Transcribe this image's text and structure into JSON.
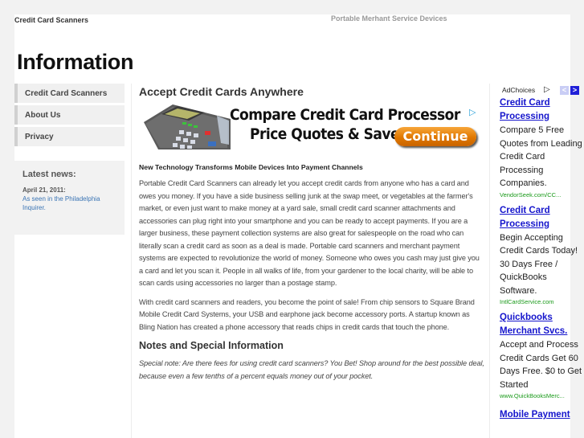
{
  "header": {
    "site_title": "Credit Card Scanners",
    "tagline": "Portable Merhant Service Devices",
    "page_heading": "Information"
  },
  "sidebar": {
    "nav": [
      {
        "label": "Credit Card Scanners"
      },
      {
        "label": "About Us"
      },
      {
        "label": "Privacy"
      }
    ],
    "news": {
      "heading": "Latest news:",
      "date": "April 21, 2011:",
      "link_text": "As seen in the Philadelphia Inquirer."
    }
  },
  "main": {
    "title": "Accept Credit Cards Anywhere",
    "banner": {
      "line1": "Compare Credit Card Processor",
      "line2": "Price Quotes & Save!",
      "button": "Continue",
      "adchoice_icon": "play-triangle-icon"
    },
    "subtitle": "New Technology Transforms Mobile Devices Into Payment Channels",
    "paragraphs": [
      "Portable Credit Card Scanners can already let you accept credit cards from anyone who has a card and owes you money. If you have a side business selling junk at the swap meet, or vegetables at the farmer's market, or even just want to make money at a yard sale, small credit card scanner attachments and accessories can plug right into your smartphone and you can be ready to accept payments. If you are a larger business, these payment collection systems are also great for salespeople on the road who can literally scan a credit card as soon as a deal is made. Portable card scanners and merchant payment systems are expected to revolutionize the world of money. Someone who owes you cash may just give you a card and let you scan it. People in all walks of life, from your gardener to the local charity, will be able to scan cards using accessories no larger than a postage stamp.",
      "With credit card scanners and readers, you become the point of sale! From chip sensors to Square Brand Mobile Credit Card Systems, your USB and earphone jack become accessory ports. A startup known as Bling Nation has created a phone accessory that reads chips in credit cards that touch the phone."
    ],
    "section_title": "Notes and Special Information",
    "note": "Special note: Are there fees for using credit card scanners? You Bet! Shop around for the best possible deal, because even a few tenths of a percent equals money out of your pocket."
  },
  "ads": {
    "adchoices_label": "AdChoices",
    "prev": "<",
    "next": ">",
    "units": [
      {
        "title": "Credit Card Processing",
        "desc": "Compare 5 Free Quotes from Leading Credit Card Processing Companies.",
        "url": "VendorSeek.com/CC..."
      },
      {
        "title": "Credit Card Processing",
        "desc": "Begin Accepting Credit Cards Today! 30 Days Free / QuickBooks Software.",
        "url": "IntlCardService.com"
      },
      {
        "title": "Quickbooks Merchant Svcs.",
        "desc": "Accept and Process Credit Cards Get 60 Days Free. $0 to Get Started",
        "url": "www.QuickBooksMerc..."
      },
      {
        "title": "Mobile Payment",
        "desc": "",
        "url": ""
      }
    ]
  }
}
